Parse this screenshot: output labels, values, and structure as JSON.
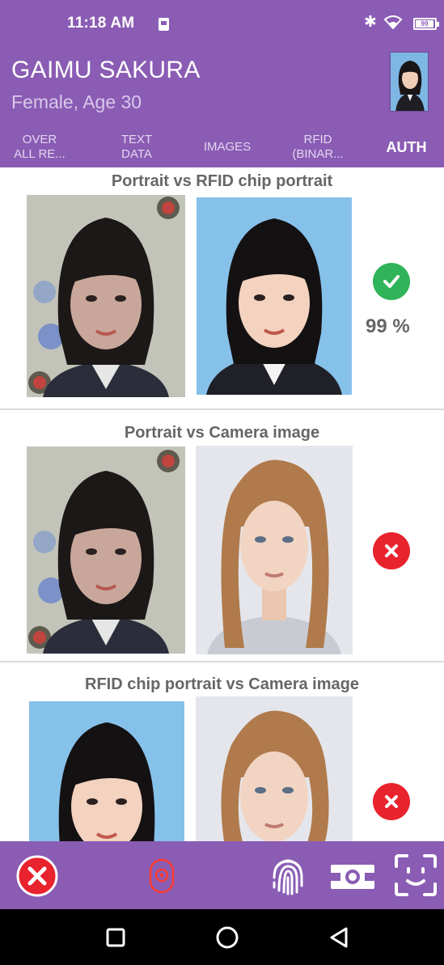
{
  "status_bar": {
    "time": "11:18 AM",
    "battery_text": "99"
  },
  "header": {
    "name": "GAIMU SAKURA",
    "details": "Female, Age 30"
  },
  "tabs": [
    {
      "label": "OVER\nALL RE...",
      "active": false
    },
    {
      "label": "TEXT\nDATA",
      "active": false
    },
    {
      "label": "IMAGES",
      "active": false
    },
    {
      "label": "RFID\n(BINAR...",
      "active": false
    },
    {
      "label": "AUTH",
      "active": true
    }
  ],
  "comparisons": [
    {
      "title": "Portrait vs RFID chip portrait",
      "result": "match",
      "score": "99 %"
    },
    {
      "title": "Portrait vs Camera image",
      "result": "mismatch",
      "score": ""
    },
    {
      "title": "RFID chip portrait vs Camera image",
      "result": "mismatch",
      "score": ""
    }
  ],
  "toolbar": {
    "icons": [
      "close-icon",
      "mouse-icon",
      "fingerprint-icon",
      "id-card-icon",
      "face-scan-icon"
    ]
  },
  "navbar": {
    "icons": [
      "recents-icon",
      "home-icon",
      "back-icon"
    ]
  },
  "colors": {
    "primary": "#8a5cb4",
    "success": "#30b45a",
    "error": "#e8232d",
    "accent_red": "#ff3b30"
  }
}
